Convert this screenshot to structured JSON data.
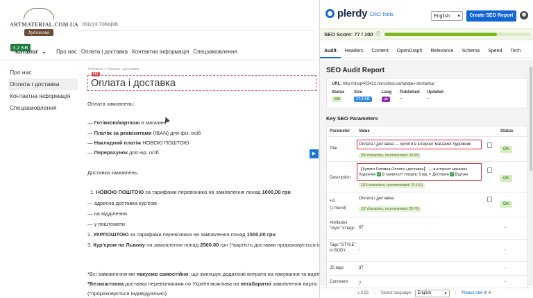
{
  "site": {
    "logo": {
      "name": "ARTMATERIAL.COM.UA",
      "sub": "Художник"
    },
    "search_placeholder": "пошук товарів",
    "kb_badge": "3.2 KB",
    "nav": {
      "catalog": "Каталог",
      "links": [
        "Про нас",
        "Оплата і доставка",
        "Контактна інформація",
        "Спецзамовлення"
      ]
    },
    "side_menu": [
      "Про нас",
      "Оплата і доставка",
      "Контактна інформація",
      "Спецзамовлення"
    ],
    "breadcrumb": "Головна  >  Оплата і доставка",
    "h1_tag": "H1",
    "h1": "Оплата і доставка",
    "payment_heading": "Оплата замовлень:",
    "payment": [
      {
        "bold": "Готівкою/карткою",
        "rest": " в магазині"
      },
      {
        "bold": "Платіж за реквізитами",
        "rest": " (IBAN) для фіз. осіб"
      },
      {
        "bold": "Накладний платіж",
        "rest": " НОВОЮ ПОШТОЮ"
      },
      {
        "bold": "Перерахунок",
        "rest": " для юр. осіб"
      }
    ],
    "delivery_heading": "Доставка замовлень:",
    "delivery": [
      {
        "num": "1.",
        "b1": "НОВОЮ ПОШТОЮ",
        "t1": " за тарифами перевізника на замовлення понад ",
        "b2": "1000,00 грн",
        "t2": ""
      },
      {
        "num": "—",
        "b1": "",
        "t1": "адресна доставка кур'єом",
        "b2": "",
        "t2": ""
      },
      {
        "num": "—",
        "b1": "",
        "t1": "на відділення",
        "b2": "",
        "t2": ""
      },
      {
        "num": "—",
        "b1": "",
        "t1": "у поштомати",
        "b2": "",
        "t2": ""
      },
      {
        "num": "2.",
        "b1": "УКРПОШТОЮ",
        "t1": " за тарифами перевізника на замовлення понад ",
        "b2": "1500,00 грн",
        "t2": ""
      },
      {
        "num": "3.",
        "b1": "Кур'єром по Львову",
        "t1": " на замовлення понад ",
        "b2": "2500.00",
        "t2": " грн (*вартість доставки прораховується інд"
      }
    ],
    "footnote1": {
      "t1": "*Всі замовлення ми ",
      "b1": "пакуємо самостійно",
      "t2": ", що зменшує додаткові витрати на пакування та вартіс"
    },
    "footnote2": {
      "b1": "*Безкоштовна",
      "t1": " доставка перевізниками по Україні можлива на ",
      "b2": "негабаритні",
      "t2": " замовлення вартіс"
    },
    "footnote3": "(*прораховується індивідуально)"
  },
  "plerdy": {
    "logo": "plerdy",
    "cro_tools": "CRO Tools",
    "language": "English",
    "create_report": "Create SEO Report",
    "seo_score_label": "SEO Score: 77 / 100",
    "seo_score_value": 77,
    "tabs": [
      "Audit",
      "Headers",
      "Content",
      "OpenGraph",
      "Relevance",
      "Schema",
      "Speed",
      "Tech"
    ],
    "active_tab": "Audit",
    "report_title": "SEO Audit Report",
    "url_label": "URL:",
    "url": "http://shop403422.horoshop.ua/oplata-i-dostavka/",
    "status_label": "Status",
    "status_value": "200",
    "size_label": "Size",
    "size_value": "27.4 KB",
    "lang_label": "Lang",
    "lang_value": "uk",
    "published_label": "Published",
    "published_value": "–",
    "updated_label": "Updated",
    "updated_value": "–",
    "kw_title": "Key SEO Parameters",
    "col_param": "Parameter",
    "col_value": "Value",
    "col_status": "Status",
    "rows": {
      "title": {
        "param": "Title",
        "value": "Оплата і доставка — купити в інтернет магазині Художник",
        "hint": "(55 characters, recommended: 30-60)",
        "status": "OK"
      },
      "description": {
        "param": "Description",
        "line1": "【Купити Головна Оплата і доставка】 — в інтернет магазині",
        "line2a": "Художник",
        "line2b": " В наявності товарів: 0 від ",
        "line2c": " Доставки ",
        "line2d": " Відгуки",
        "hint": "(115 characters, recommended: 70-160)",
        "status": "OK"
      },
      "h1": {
        "param": "H1",
        "found": "(1 found)",
        "value": "Оплата і доставка",
        "hint": "(17 characters, recommended: 20-70)",
        "status": "OK"
      },
      "style_attr": {
        "param": "Attributes \"style\" in tags",
        "value": "67",
        "status": "-"
      },
      "style_tags": {
        "param": "Tags \"STYLE\" in BODY",
        "value": "-",
        "status": "-"
      },
      "js": {
        "param": "JS tags",
        "value": "37",
        "status": "-"
      },
      "comment": {
        "param": "Comment",
        "value": "7",
        "status": "-"
      }
    },
    "footer": {
      "version": "v 3.55",
      "select_language": "Select language:",
      "language": "English",
      "rate": "Please rate it!"
    }
  }
}
